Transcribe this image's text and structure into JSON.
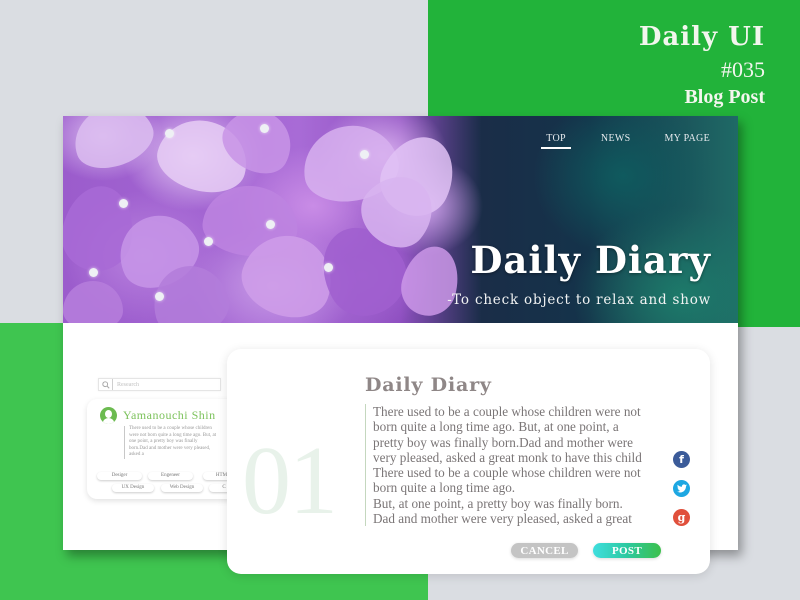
{
  "shot": {
    "title": "Daily UI",
    "number": "#035",
    "subtitle": "Blog Post"
  },
  "colors": {
    "brand_green": "#22b33a",
    "light_green": "#3fc550",
    "background_gray": "#dadde2",
    "profile_green": "#7cc25b",
    "facebook": "#3b5b99",
    "twitter": "#1da7e2",
    "google_plus": "#e0503c"
  },
  "nav": {
    "items": [
      {
        "label": "TOP",
        "active": true
      },
      {
        "label": "NEWS",
        "active": false
      },
      {
        "label": "MY PAGE",
        "active": false
      }
    ]
  },
  "hero": {
    "title": "Daily Diary",
    "subtitle": "-To check object to relax and show",
    "image": "purple-hydrangea-photo"
  },
  "search": {
    "placeholder": "Research",
    "value": "",
    "icon": "search-icon"
  },
  "profile": {
    "name": "Yamanouchi  Shin",
    "avatar_icon": "user-avatar-icon",
    "excerpt": "There used to be a couple whose children were not born quite a long time ago. But, at one point, a pretty boy was finally born.Dad and mother were very pleased, asked a",
    "tags_row1": [
      "Desiger",
      "Engeneer",
      "HTML"
    ],
    "tags_row2": [
      "UX Design",
      "Web Design",
      "C"
    ]
  },
  "post": {
    "number": "01",
    "title": "Daily Diary",
    "lines": [
      "There used to be a couple whose children were not",
      "born quite a long time ago. But, at one point, a",
      "pretty boy was finally born.Dad and mother were",
      "very pleased, asked a great monk to have this child",
      "There used to be a couple whose children were not",
      "born quite a long time ago.",
      "But, at one point, a pretty boy was finally born.",
      "Dad and mother were very pleased, asked a great"
    ],
    "share": [
      {
        "name": "facebook",
        "glyph": "f"
      },
      {
        "name": "twitter",
        "glyph": "🐦"
      },
      {
        "name": "google-plus",
        "glyph": "g"
      }
    ],
    "cancel_label": "CANCEL",
    "post_label": "POST"
  }
}
